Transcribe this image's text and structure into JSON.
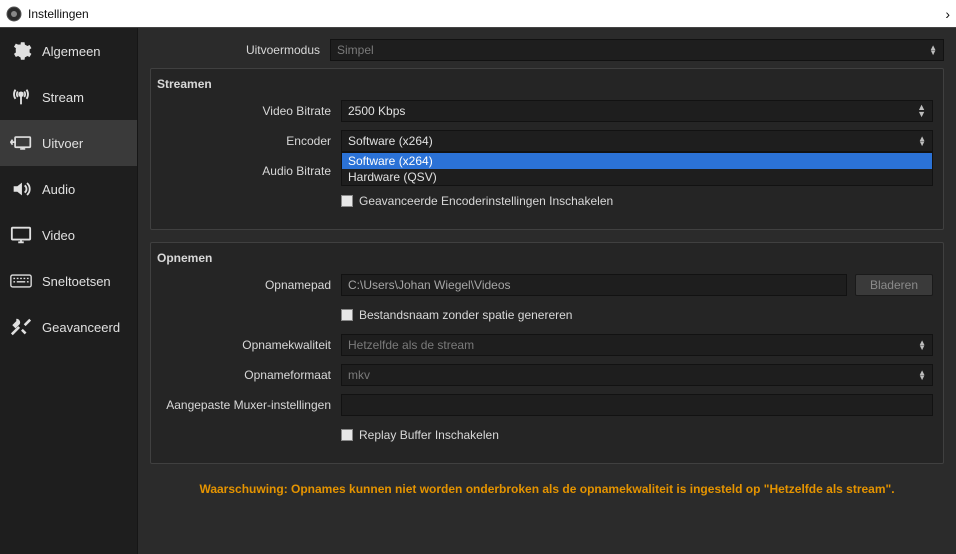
{
  "window": {
    "title": "Instellingen"
  },
  "sidebar": {
    "items": [
      {
        "label": "Algemeen"
      },
      {
        "label": "Stream"
      },
      {
        "label": "Uitvoer"
      },
      {
        "label": "Audio"
      },
      {
        "label": "Video"
      },
      {
        "label": "Sneltoetsen"
      },
      {
        "label": "Geavanceerd"
      }
    ]
  },
  "output_mode": {
    "label": "Uitvoermodus",
    "value": "Simpel"
  },
  "streaming": {
    "group_title": "Streamen",
    "video_bitrate_label": "Video Bitrate",
    "video_bitrate_value": "2500 Kbps",
    "encoder_label": "Encoder",
    "encoder_value": "Software (x264)",
    "encoder_options": [
      "Software (x264)",
      "Hardware (QSV)"
    ],
    "audio_bitrate_label": "Audio Bitrate",
    "advanced_checkbox": "Geavanceerde Encoderinstellingen Inschakelen"
  },
  "recording": {
    "group_title": "Opnemen",
    "path_label": "Opnamepad",
    "path_value": "C:\\Users\\Johan Wiegel\\Videos",
    "browse_button": "Bladeren",
    "nospace_checkbox": "Bestandsnaam zonder spatie genereren",
    "quality_label": "Opnamekwaliteit",
    "quality_value": "Hetzelfde als de stream",
    "format_label": "Opnameformaat",
    "format_value": "mkv",
    "muxer_label": "Aangepaste Muxer-instellingen",
    "replay_checkbox": "Replay Buffer Inschakelen"
  },
  "warning": "Waarschuwing: Opnames kunnen niet worden onderbroken als de opnamekwaliteit is ingesteld op \"Hetzelfde als stream\"."
}
